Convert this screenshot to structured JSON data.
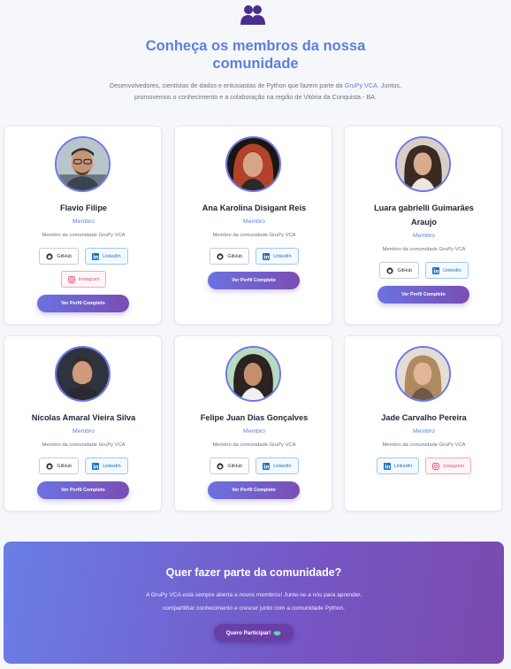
{
  "header": {
    "icon": "users-icon",
    "title_line1": "Conheça os membros da nossa",
    "title_line2": "comunidade",
    "intro_part1": "Desenvolvedores, cientistas de dados e entusiastas de Python que fazem parte da ",
    "intro_highlight": "GruPy VCA",
    "intro_part2": ". Juntos,",
    "intro_line2": "promovemos o conhecimento e a colaboração na região de Vitória da Conquista - BA."
  },
  "members": [
    {
      "name": "Flavio Filipe",
      "role": "Membro",
      "desc": "Membro da comunidade GruPy VCA",
      "github": "GitHub",
      "linkedin": "LinkedIn",
      "instagram": "Instagram",
      "profile": "Ver Perfil Completo"
    },
    {
      "name": "Ana Karolina Disigant Reis",
      "role": "Membro",
      "desc": "Membro da comunidade GruPy VCA",
      "github": "GitHub",
      "linkedin": "LinkedIn",
      "profile": "Ver Perfil Completo"
    },
    {
      "name_line1": "Luara gabrielli Guimarães",
      "name_line2": "Araujo",
      "role": "Membro",
      "desc": "Membro da comunidade GruPy VCA",
      "github": "GitHub",
      "linkedin": "LinkedIn",
      "profile": "Ver Perfil Completo"
    },
    {
      "name": "Nícolas Amaral Vieira Silva",
      "role": "Membro",
      "desc": "Membro da comunidade GruPy VCA",
      "github": "GitHub",
      "linkedin": "LinkedIn",
      "profile": "Ver Perfil Completo"
    },
    {
      "name": "Felipe Juan Dias Gonçalves",
      "role": "Membro",
      "desc": "Membro da comunidade GruPy VCA",
      "github": "GitHub",
      "linkedin": "LinkedIn",
      "profile": "Ver Perfil Completo"
    },
    {
      "name": "Jade Carvalho Pereira",
      "role": "Membro",
      "desc": "Membro da comunidade GruPy VCA",
      "linkedin": "LinkedIn",
      "instagram": "Instagram"
    }
  ],
  "cta": {
    "title": "Quer fazer parte da comunidade?",
    "text_line1": "A GruPy VCA está sempre aberta a novos membros! Junte-se a nós para aprender,",
    "text_line2": "compartilhar conhecimento e crescer junto com a comunidade Python.",
    "button": "Quero Participar!",
    "button_icon": "handshake-icon"
  },
  "colors": {
    "accent": "#5b7fe0",
    "gradient_start": "#6b72e0",
    "gradient_end": "#7a4db5",
    "linkedin": "#1a74c2",
    "instagram": "#e0567b"
  }
}
